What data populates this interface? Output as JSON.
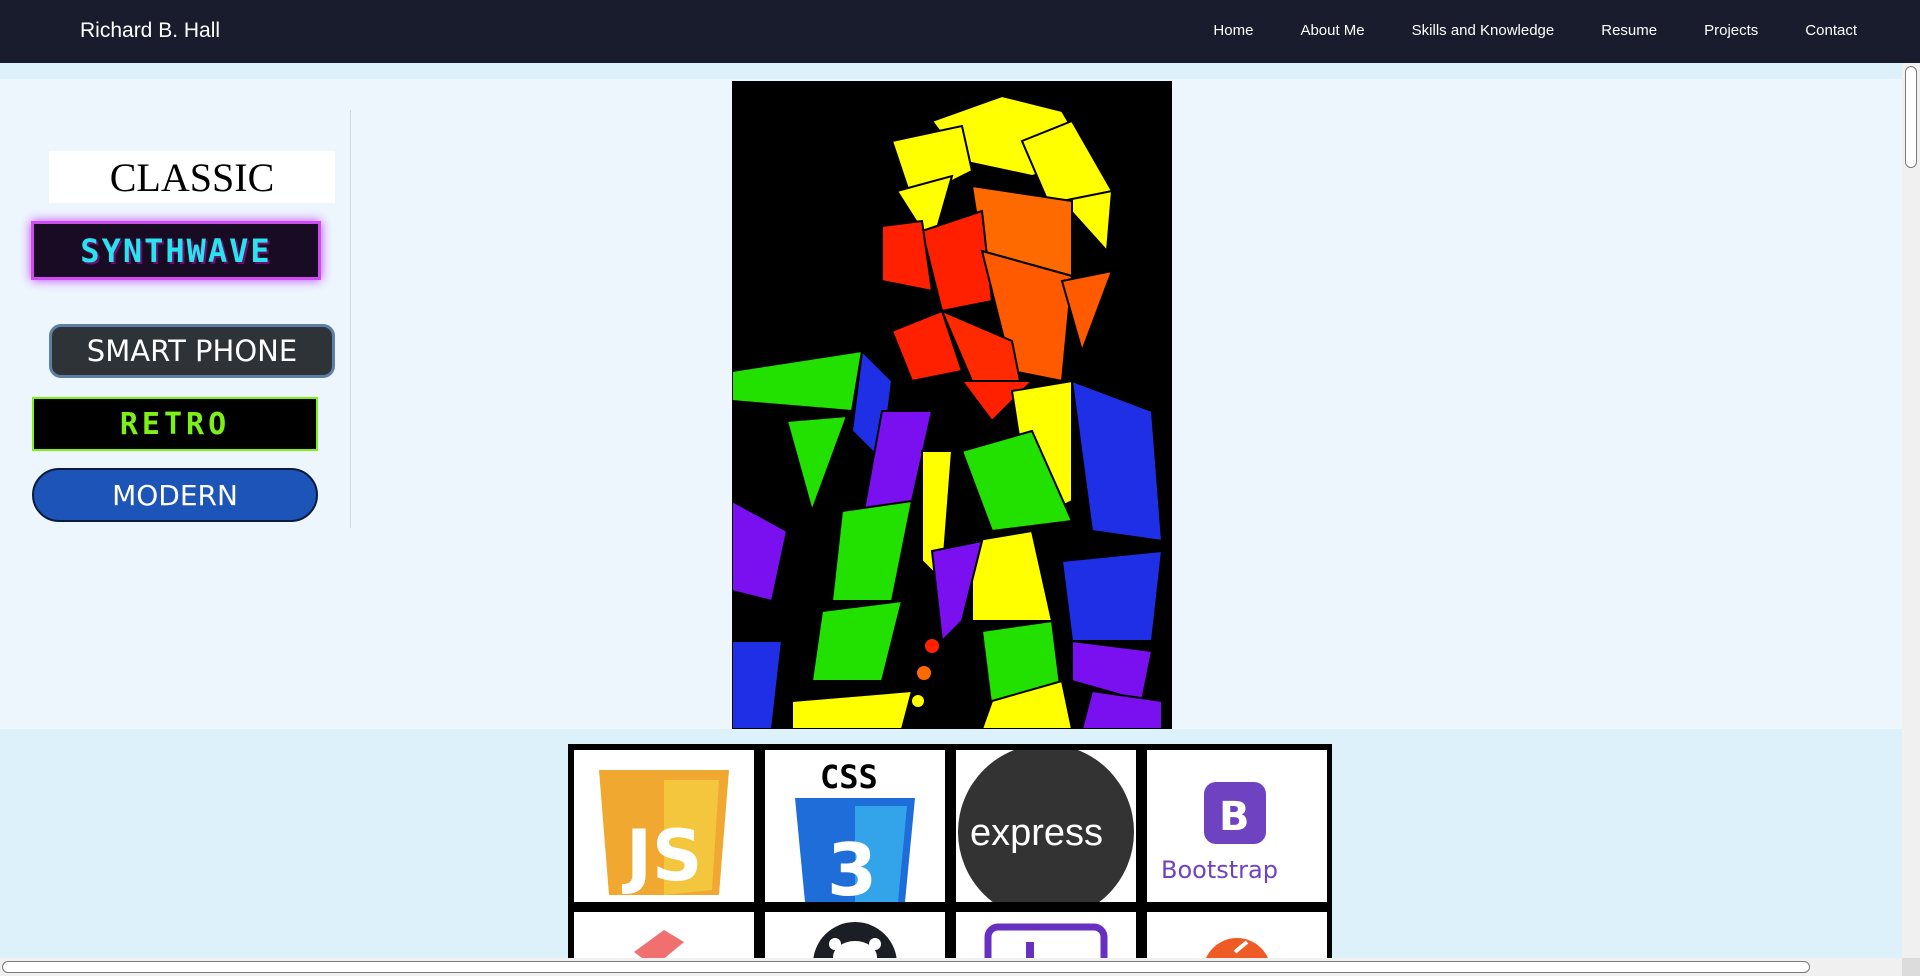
{
  "navbar": {
    "brand": "Richard B. Hall",
    "links": [
      "Home",
      "About Me",
      "Skills and Knowledge",
      "Resume",
      "Projects",
      "Contact"
    ],
    "background": "#181c2c"
  },
  "theme_buttons": {
    "classic": "CLASSIC",
    "synthwave": "SYNTHWAVE",
    "smart_phone": "SMART PHONE",
    "retro": "RETRO",
    "modern": "MODERN"
  },
  "hero": {
    "portrait_alt": "stained-glass portrait"
  },
  "skills": {
    "logos": [
      {
        "name": "javascript-logo",
        "label": "JS"
      },
      {
        "name": "css3-logo",
        "label": "CSS"
      },
      {
        "name": "express-logo",
        "label": "express"
      },
      {
        "name": "bootstrap-logo",
        "label": "Bootstrap"
      }
    ]
  },
  "colors": {
    "page_background": "#edf6fd",
    "lower_background": "#dcf1f9",
    "synthwave_text": "#29e3ef",
    "synthwave_border": "#d04bf0",
    "retro_green": "#7df018",
    "modern_blue": "#1d54b8"
  }
}
